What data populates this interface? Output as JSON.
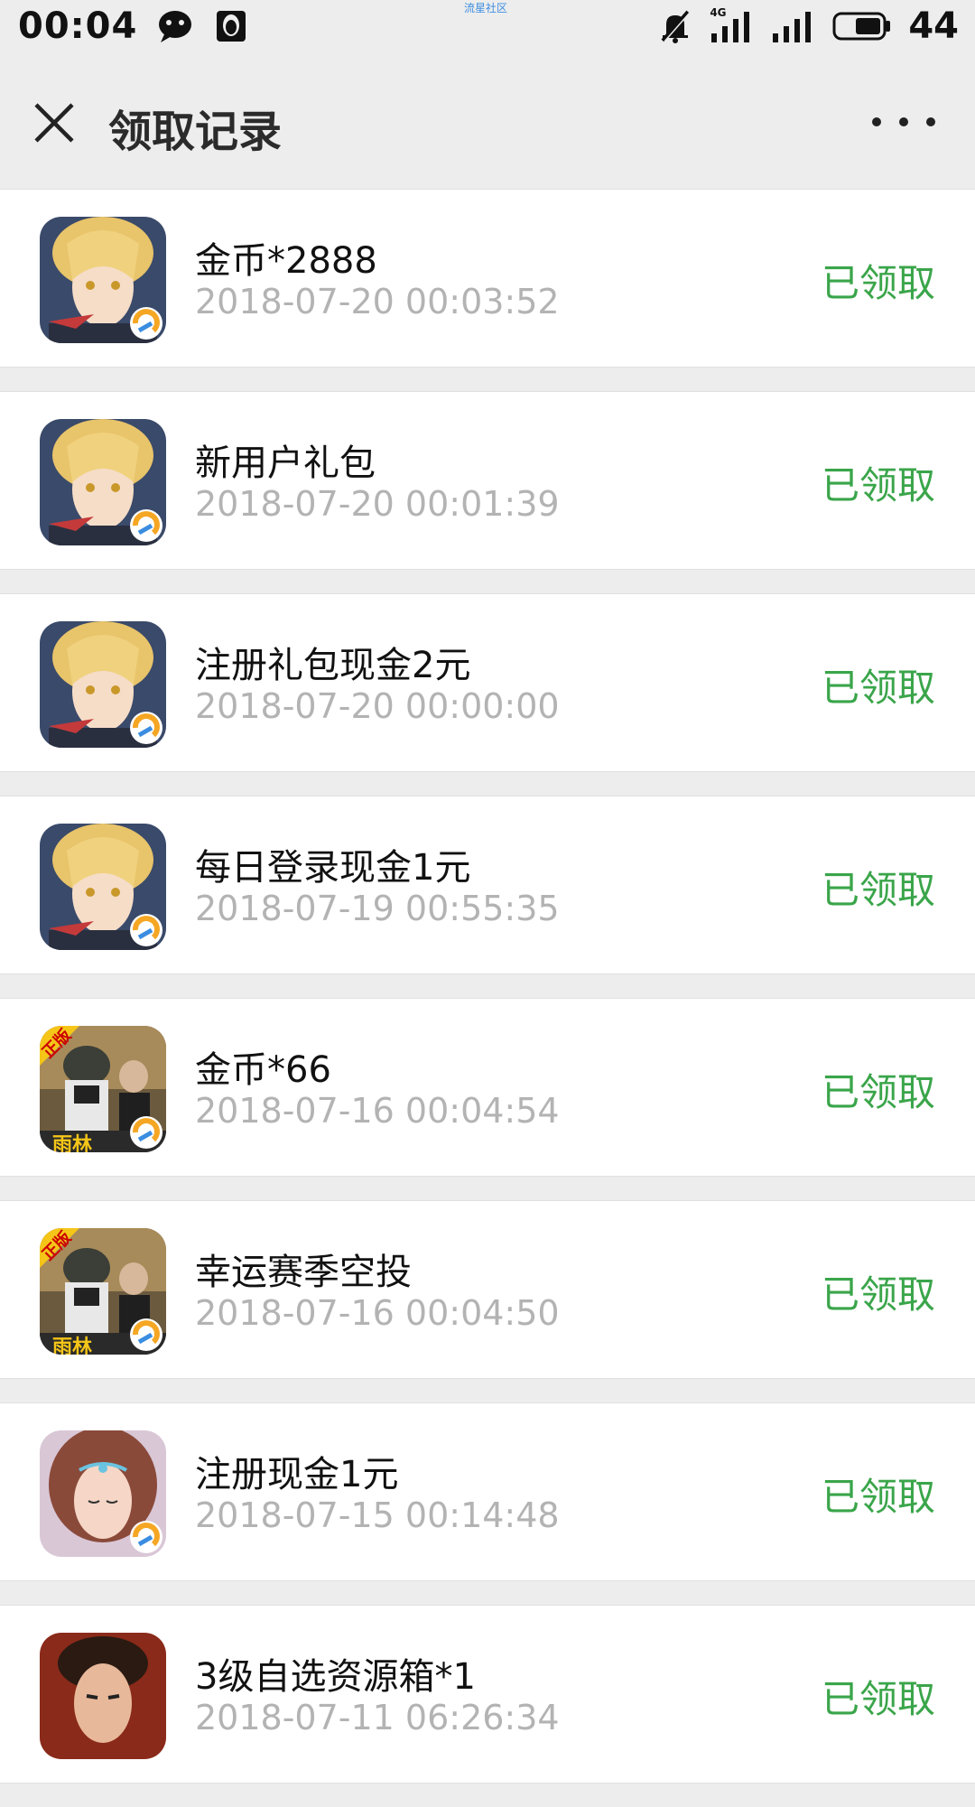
{
  "status_bar": {
    "time": "00:04",
    "watermark": "流星社区",
    "network": "4G",
    "battery": "44"
  },
  "nav": {
    "title": "领取记录"
  },
  "records": [
    {
      "title": "金币*2888",
      "time": "2018-07-20 00:03:52",
      "status": "已领取",
      "icon": "anime-blond-hero-game-icon"
    },
    {
      "title": "新用户礼包",
      "time": "2018-07-20 00:01:39",
      "status": "已领取",
      "icon": "anime-blond-hero-game-icon"
    },
    {
      "title": "注册礼包现金2元",
      "time": "2018-07-20 00:00:00",
      "status": "已领取",
      "icon": "anime-blond-hero-game-icon"
    },
    {
      "title": "每日登录现金1元",
      "time": "2018-07-19 00:55:35",
      "status": "已领取",
      "icon": "anime-blond-hero-game-icon"
    },
    {
      "title": "金币*66",
      "time": "2018-07-16 00:04:54",
      "status": "已领取",
      "icon": "battle-royale-game-icon",
      "badge": "正版",
      "banner": "雨林"
    },
    {
      "title": "幸运赛季空投",
      "time": "2018-07-16 00:04:50",
      "status": "已领取",
      "icon": "battle-royale-game-icon",
      "badge": "正版",
      "banner": "雨林"
    },
    {
      "title": "注册现金1元",
      "time": "2018-07-15 00:14:48",
      "status": "已领取",
      "icon": "fantasy-heroine-game-icon"
    },
    {
      "title": "3级自选资源箱*1",
      "time": "2018-07-11 06:26:34",
      "status": "已领取",
      "icon": "warrior-hero-game-icon"
    }
  ],
  "colors": {
    "status_green": "#3aa54a",
    "page_bg": "#ededed",
    "time_gray": "#b3b3b3"
  }
}
